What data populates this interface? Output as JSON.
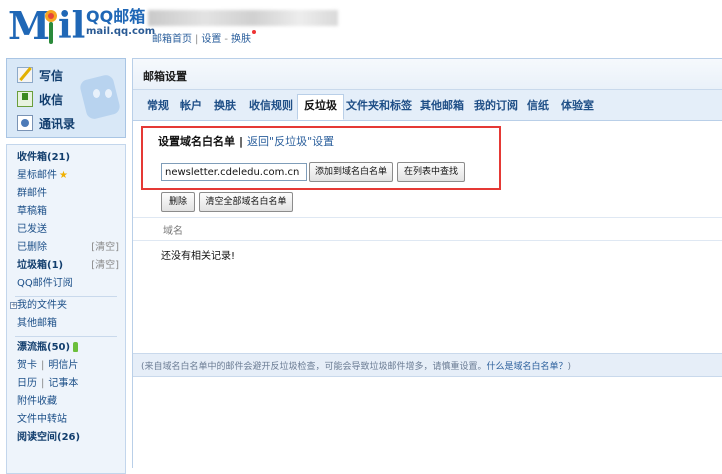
{
  "header": {
    "brand_name": "QQ邮箱",
    "brand_url": "mail.qq.com",
    "links": [
      "邮箱首页",
      "设置",
      "换肤"
    ]
  },
  "sidebar": {
    "quick": [
      "写信",
      "收信",
      "通讯录"
    ],
    "folders": {
      "inbox": "收件箱(21)",
      "starred": "星标邮件",
      "group": "群邮件",
      "drafts": "草稿箱",
      "sent": "已发送",
      "deleted": "已删除",
      "deleted_action": "[清空]",
      "spam": "垃圾箱(1)",
      "spam_action": "[清空]",
      "subscriptions": "QQ邮件订阅",
      "my_folders": "我的文件夹",
      "other_mail": "其他邮箱",
      "drift_bottle": "漂流瓶(50)",
      "cards": "贺卡",
      "postcards": "明信片",
      "calendar": "日历",
      "notebook": "记事本",
      "attachments": "附件收藏",
      "file_transfer": "文件中转站",
      "reading": "阅读空间(26)"
    }
  },
  "main": {
    "title": "邮箱设置",
    "tabs": [
      "常规",
      "帐户",
      "换肤",
      "收信规则",
      "反垃圾",
      "文件夹和标签",
      "其他邮箱",
      "我的订阅",
      "信纸",
      "体验室"
    ],
    "active_tab": "反垃圾",
    "section_title": "设置域名白名单",
    "back_link": "返回\"反垃圾\"设置",
    "domain_input_value": "newsletter.cdeledu.com.cn",
    "add_button": "添加到域名白名单",
    "search_button": "在列表中查找",
    "delete_button": "删除",
    "clear_button": "清空全部域名白名单",
    "column_header": "域名",
    "empty_message": "还没有相关记录!",
    "footnote": "(来自域名白名单中的邮件会避开反垃圾检查，可能会导致垃圾邮件增多，请慎重设置。",
    "footnote_link": "什么是域名白名单？",
    "footnote_end": ")"
  },
  "colors": {
    "brand_blue": "#1f67b6",
    "tab_bar": "#e4eef9",
    "highlight_red": "#e53935"
  }
}
